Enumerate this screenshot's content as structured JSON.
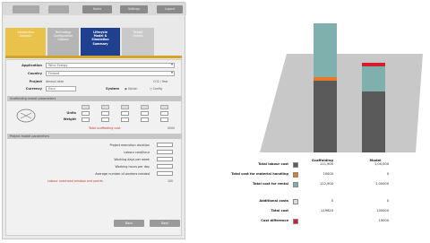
{
  "topbar": {
    "buttons": [
      "",
      "",
      "Home",
      "Settings",
      "Logout"
    ]
  },
  "tabs": [
    {
      "label": "Introduction\nAnalysis"
    },
    {
      "label": "Technology\nConfiguration\nOptions"
    },
    {
      "label": "Lifecycle\nModel &\nSimulation\nSummary"
    },
    {
      "label": "Report\nDetails"
    }
  ],
  "form": {
    "application_label": "Application",
    "application_value": "Wind Energy",
    "country_label": "Country",
    "country_value": "Finland",
    "project_label": "Project",
    "project_value": "Aerosol data",
    "project_extra": "CO2 / Year",
    "currency_label": "Currency",
    "currency_value": "Euro",
    "system_label": "System",
    "system_option_a": "Option",
    "system_option_b": "Config",
    "section1": "Scaffolding model parameters",
    "grid_row_labels": [
      "Units",
      "Weight"
    ],
    "grid_headers": [
      "",
      "",
      "",
      "",
      ""
    ],
    "total_label": "Total scaffolding cost",
    "total_value": "0000",
    "section2": "Project model parameters",
    "params": [
      "Project execution duration",
      "Labour cost/hour",
      "Working days per week",
      "Working hours per day",
      "Average number of workers needed"
    ],
    "param_red": "Labour overhead window and points",
    "param_red_value": "100",
    "btn_back": "Back",
    "btn_next": "Next"
  },
  "chart_data": {
    "type": "bar",
    "categories": [
      "Scaffolding",
      "Model"
    ],
    "series": [
      {
        "name": "Total labour cost",
        "values": [
          4,
          3
        ],
        "color": "#5a5a5a"
      },
      {
        "name": "Total cost for material handling",
        "values": [
          1,
          0
        ],
        "color": "#e8782a"
      },
      {
        "name": "Total cost for rental",
        "values": [
          15,
          7
        ],
        "color": "#7fb0ae"
      },
      {
        "name": "Additional costs",
        "values": [
          0,
          0
        ],
        "color": "#dddddd"
      },
      {
        "name": "Cost difference",
        "values": [
          0,
          1
        ],
        "color": "#d21f2b"
      }
    ],
    "stack_base": [
      16,
      14
    ],
    "ylim": [
      0,
      40
    ]
  },
  "legend": {
    "rows": [
      {
        "label": "Total labour cost",
        "color": "#5a5a5a",
        "v1": "111,900",
        "v2": "1,00,000"
      },
      {
        "label": "Total cost for material handling",
        "color": "#e8782a",
        "v1": "10000",
        "v2": "0"
      },
      {
        "label": "Total cost for rental",
        "color": "#7fb0ae",
        "v1": "112,900",
        "v2": "1,00000"
      },
      {
        "label": "Additional costs",
        "color": "#dddddd",
        "v1": "0",
        "v2": "0"
      },
      {
        "label": "Total cost",
        "color": "",
        "v1": "119620",
        "v2": "100000"
      },
      {
        "label": "Cost difference",
        "color": "#d21f2b",
        "v1": "",
        "v2": "19000"
      }
    ]
  }
}
